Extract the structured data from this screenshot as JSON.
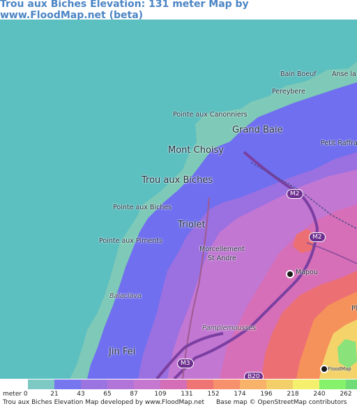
{
  "title": "Trou aux Biches Elevation: 131 meter Map by www.FloodMap.net (beta)",
  "map": {
    "place_labels": [
      {
        "text": "Anse la",
        "size": "small"
      },
      {
        "text": "Bain Boeuf",
        "size": "small"
      },
      {
        "text": "Pereybere",
        "size": "small"
      },
      {
        "text": "Pointe aux Canonniers",
        "size": "small"
      },
      {
        "text": "Grand Baie",
        "size": "big"
      },
      {
        "text": "Petit Raffra",
        "size": "small"
      },
      {
        "text": "Mont Choisy",
        "size": "big"
      },
      {
        "text": "Trou aux Biches",
        "size": "big"
      },
      {
        "text": "Pointe aux Biches",
        "size": "small"
      },
      {
        "text": "Triolet",
        "size": "big"
      },
      {
        "text": "Morcellement",
        "size": "small"
      },
      {
        "text": "St Andre",
        "size": "small"
      },
      {
        "text": "Pointe aux Piments",
        "size": "small"
      },
      {
        "text": "Mapou",
        "size": "small"
      },
      {
        "text": "Balaclava",
        "size": "small"
      },
      {
        "text": "Pamplemousses",
        "size": "small"
      },
      {
        "text": "Jin Fei",
        "size": "big"
      },
      {
        "text": "Pl",
        "size": "small"
      }
    ],
    "road_shields": [
      "M2",
      "M2",
      "M3",
      "B20"
    ],
    "marker_label": "FloodMap",
    "colors": {
      "sea": "#5cbfc0",
      "coast": "#7ec9b7",
      "low_blue": "#6f6ff0",
      "purple": "#9b70e0",
      "magenta": "#c277d3",
      "pink": "#d66fb8",
      "red": "#ec6f74",
      "orange": "#f5915a",
      "yellow": "#f3d36a",
      "green": "#89e27a"
    }
  },
  "legend": {
    "unit": "meter 0",
    "ticks": [
      "21",
      "43",
      "65",
      "87",
      "109",
      "131",
      "152",
      "174",
      "196",
      "218",
      "240",
      "262"
    ],
    "swatches": [
      "#7ec9c3",
      "#7676ee",
      "#9a74e0",
      "#b174d8",
      "#c677cf",
      "#d46fb7",
      "#ef7474",
      "#f7906c",
      "#f9b26a",
      "#f3cf6a",
      "#f4f06e",
      "#86f16a",
      "#6fdc78"
    ],
    "credit_left": "Trou aux Biches Elevation Map developed by www.FloodMap.net",
    "credit_right": "Base map © OpenStreetMap contributors"
  }
}
